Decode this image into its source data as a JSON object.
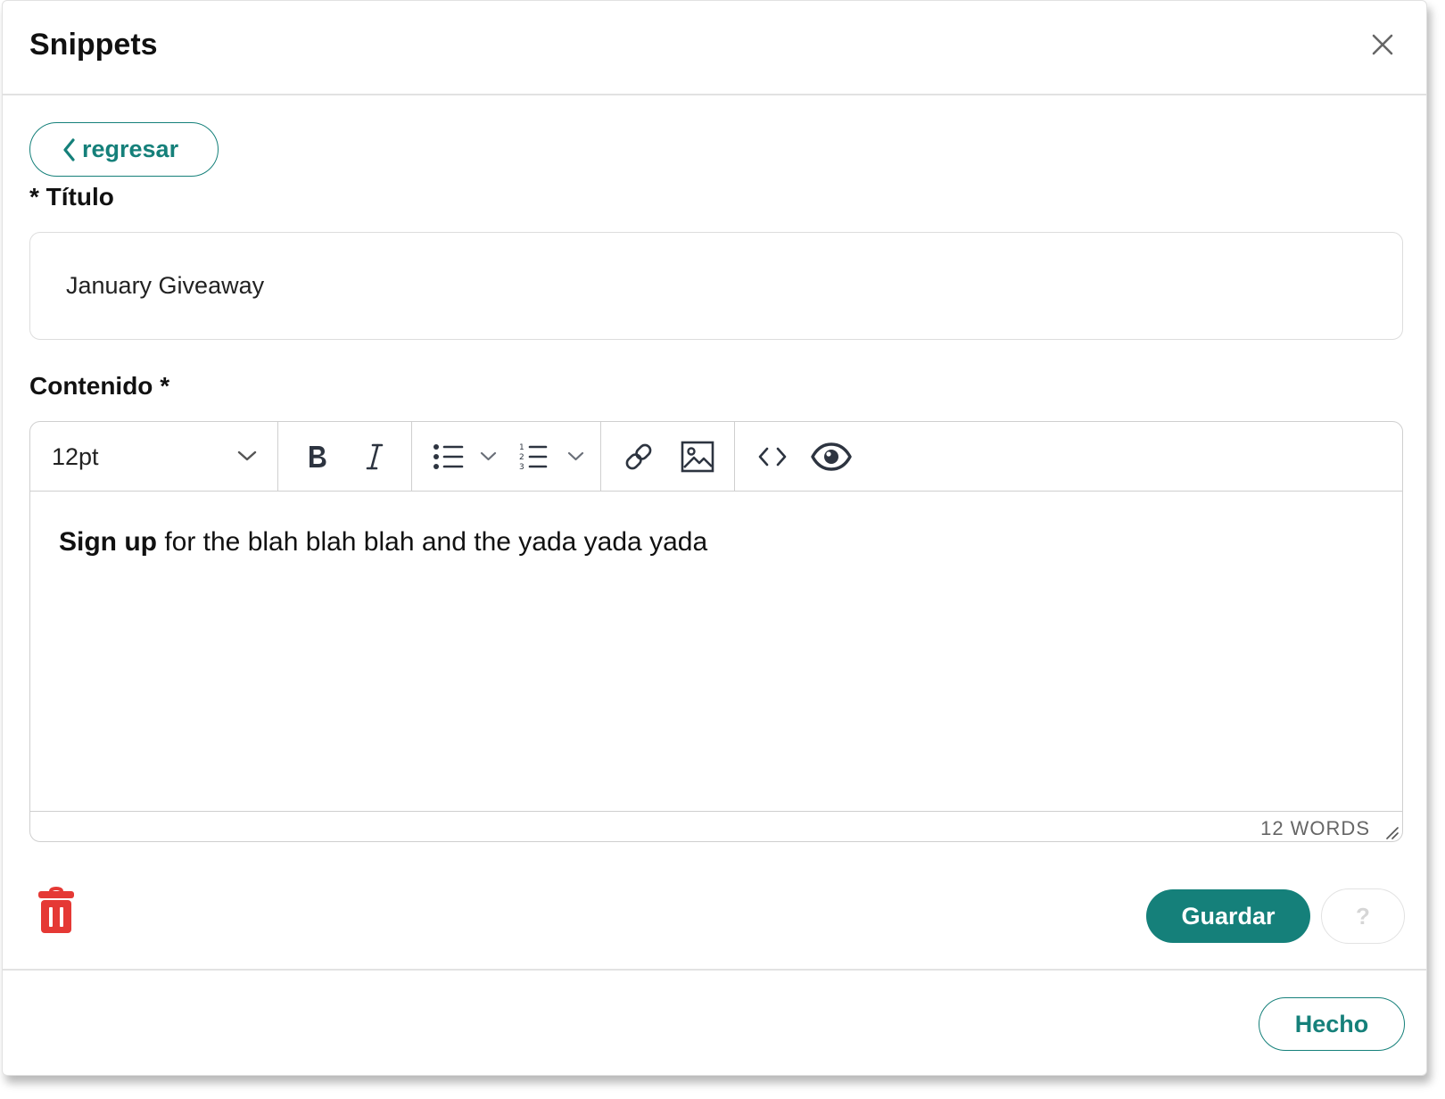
{
  "modal": {
    "title": "Snippets"
  },
  "back_button": {
    "label": "regresar"
  },
  "title_field": {
    "label": "* Título",
    "value": "January Giveaway"
  },
  "content_field": {
    "label": "Contenido *",
    "toolbar": {
      "font_size": "12pt",
      "icons": [
        "chevron-down-icon",
        "bold-icon",
        "italic-icon",
        "bullet-list-icon",
        "numbered-list-icon",
        "link-icon",
        "image-icon",
        "code-icon",
        "preview-eye-icon"
      ]
    },
    "body": {
      "bold_text": "Sign up",
      "rest_text": " for the blah blah blah and the yada yada yada"
    },
    "word_count": "12 WORDS"
  },
  "actions": {
    "save_label": "Guardar",
    "help_label": "?",
    "done_label": "Hecho"
  },
  "colors": {
    "accent": "#15807a",
    "danger": "#e53935",
    "border": "#cfcfcf"
  }
}
